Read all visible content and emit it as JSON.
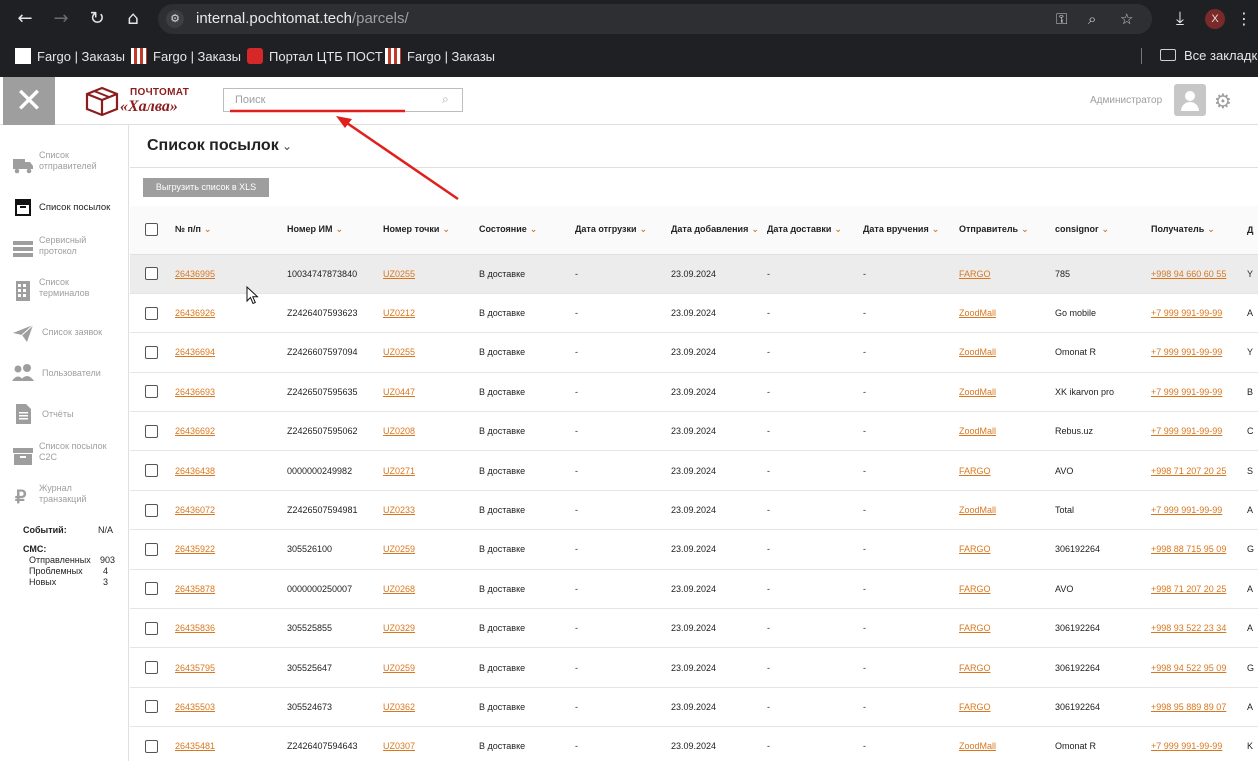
{
  "browser": {
    "url_host": "internal.pochtomat.tech",
    "url_path": "/parcels/",
    "profile_initial": "X",
    "bookmarks": [
      {
        "label": "Fargo | Заказы"
      },
      {
        "label": "Fargo | Заказы"
      },
      {
        "label": "Портал ЦТБ ПОСТ"
      },
      {
        "label": "Fargo | Заказы"
      }
    ],
    "all_bookmarks": "Все закладки"
  },
  "app": {
    "logo_line1": "ПОЧТОМАТ",
    "logo_line2": "«Халва»",
    "search_placeholder": "Поиск",
    "user_label": "Администратор",
    "accent_color": "#d9771f"
  },
  "sidebar": {
    "items": [
      {
        "label": "Список\nотправителей",
        "icon": "truck-icon"
      },
      {
        "label": "Список посылок",
        "icon": "box-icon",
        "active": true
      },
      {
        "label": "Сервисный\nпротокол",
        "icon": "server-icon"
      },
      {
        "label": "Список\nтерминалов",
        "icon": "terminal-icon"
      },
      {
        "label": "Список заявок",
        "icon": "paper-plane-icon"
      },
      {
        "label": "Пользователи",
        "icon": "users-icon"
      },
      {
        "label": "Отчёты",
        "icon": "document-icon"
      },
      {
        "label": "Список посылок\nC2C",
        "icon": "archive-icon"
      },
      {
        "label": "Журнал\nтранзакций",
        "icon": "ruble-icon"
      }
    ],
    "stats": {
      "events_label": "Событий:",
      "events_value": "N/A",
      "sms_label": "СМС:",
      "sent_label": "Отправленных",
      "sent_value": "903",
      "problem_label": "Проблемных",
      "problem_value": "4",
      "new_label": "Новых",
      "new_value": "3"
    }
  },
  "main": {
    "title": "Список посылок",
    "export_label": "Выгрузить список в XLS",
    "columns": [
      "№ п/п",
      "Номер ИМ",
      "Номер точки",
      "Состояние",
      "Дата отгрузки",
      "Дата добавления",
      "Дата доставки",
      "Дата вручения",
      "Отправитель",
      "consignor",
      "Получатель",
      "Д"
    ],
    "rows": [
      {
        "id": "26436995",
        "im": "10034747873840",
        "point": "UZ0255",
        "state": "В доставке",
        "ship": "-",
        "added": "23.09.2024",
        "deliv": "-",
        "handed": "-",
        "sender": "FARGO",
        "consignor": "785",
        "recipient": "+998 94 660 60 55",
        "extra": "Y"
      },
      {
        "id": "26436926",
        "im": "Z2426407593623",
        "point": "UZ0212",
        "state": "В доставке",
        "ship": "-",
        "added": "23.09.2024",
        "deliv": "-",
        "handed": "-",
        "sender": "ZoodMall",
        "consignor": "Go mobile",
        "recipient": "+7 999 991-99-99",
        "extra": "A"
      },
      {
        "id": "26436694",
        "im": "Z2426607597094",
        "point": "UZ0255",
        "state": "В доставке",
        "ship": "-",
        "added": "23.09.2024",
        "deliv": "-",
        "handed": "-",
        "sender": "ZoodMall",
        "consignor": "Omonat R",
        "recipient": "+7 999 991-99-99",
        "extra": "Y"
      },
      {
        "id": "26436693",
        "im": "Z2426507595635",
        "point": "UZ0447",
        "state": "В доставке",
        "ship": "-",
        "added": "23.09.2024",
        "deliv": "-",
        "handed": "-",
        "sender": "ZoodMall",
        "consignor": "XK ikarvon pro",
        "recipient": "+7 999 991-99-99",
        "extra": "B"
      },
      {
        "id": "26436692",
        "im": "Z2426507595062",
        "point": "UZ0208",
        "state": "В доставке",
        "ship": "-",
        "added": "23.09.2024",
        "deliv": "-",
        "handed": "-",
        "sender": "ZoodMall",
        "consignor": "Rebus.uz",
        "recipient": "+7 999 991-99-99",
        "extra": "C"
      },
      {
        "id": "26436438",
        "im": "0000000249982",
        "point": "UZ0271",
        "state": "В доставке",
        "ship": "-",
        "added": "23.09.2024",
        "deliv": "-",
        "handed": "-",
        "sender": "FARGO",
        "consignor": "AVO",
        "recipient": "+998 71 207 20 25",
        "extra": "S"
      },
      {
        "id": "26436072",
        "im": "Z2426507594981",
        "point": "UZ0233",
        "state": "В доставке",
        "ship": "-",
        "added": "23.09.2024",
        "deliv": "-",
        "handed": "-",
        "sender": "ZoodMall",
        "consignor": "Total",
        "recipient": "+7 999 991-99-99",
        "extra": "A"
      },
      {
        "id": "26435922",
        "im": "305526100",
        "point": "UZ0259",
        "state": "В доставке",
        "ship": "-",
        "added": "23.09.2024",
        "deliv": "-",
        "handed": "-",
        "sender": "FARGO",
        "consignor": "306192264",
        "recipient": "+998 88 715 95 09",
        "extra": "G"
      },
      {
        "id": "26435878",
        "im": "0000000250007",
        "point": "UZ0268",
        "state": "В доставке",
        "ship": "-",
        "added": "23.09.2024",
        "deliv": "-",
        "handed": "-",
        "sender": "FARGO",
        "consignor": "AVO",
        "recipient": "+998 71 207 20 25",
        "extra": "A"
      },
      {
        "id": "26435836",
        "im": "305525855",
        "point": "UZ0329",
        "state": "В доставке",
        "ship": "-",
        "added": "23.09.2024",
        "deliv": "-",
        "handed": "-",
        "sender": "FARGO",
        "consignor": "306192264",
        "recipient": "+998 93 522 23 34",
        "extra": "A"
      },
      {
        "id": "26435795",
        "im": "305525647",
        "point": "UZ0259",
        "state": "В доставке",
        "ship": "-",
        "added": "23.09.2024",
        "deliv": "-",
        "handed": "-",
        "sender": "FARGO",
        "consignor": "306192264",
        "recipient": "+998 94 522 95 09",
        "extra": "G"
      },
      {
        "id": "26435503",
        "im": "305524673",
        "point": "UZ0362",
        "state": "В доставке",
        "ship": "-",
        "added": "23.09.2024",
        "deliv": "-",
        "handed": "-",
        "sender": "FARGO",
        "consignor": "306192264",
        "recipient": "+998 95 889 89 07",
        "extra": "A"
      },
      {
        "id": "26435481",
        "im": "Z2426407594643",
        "point": "UZ0307",
        "state": "В доставке",
        "ship": "-",
        "added": "23.09.2024",
        "deliv": "-",
        "handed": "-",
        "sender": "ZoodMall",
        "consignor": "Omonat R",
        "recipient": "+7 999 991-99-99",
        "extra": "K"
      }
    ]
  }
}
